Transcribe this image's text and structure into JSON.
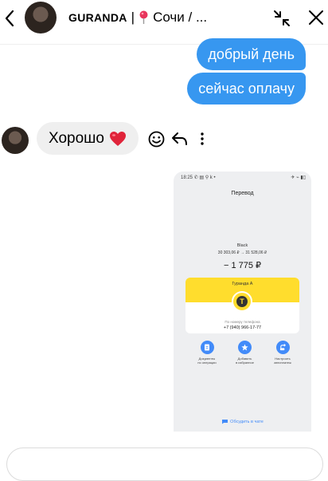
{
  "header": {
    "back_icon": "chevron-left-icon",
    "username": "GURANDA",
    "separator": "|",
    "location": "Сочи / ...",
    "collapse_icon": "collapse-arrows-icon",
    "close_icon": "close-icon"
  },
  "messages": {
    "outgoing": [
      {
        "text": "добрый день"
      },
      {
        "text": "сейчас оплачу"
      }
    ],
    "incoming": {
      "text": "Хорошо",
      "emoji": "heart-icon"
    }
  },
  "screenshot": {
    "status_time": "18:25",
    "status_icons": "✆ ▤ ⚲ k •",
    "status_right": "✈ ⌁ ▮▯",
    "title": "Перевод",
    "category": "Black",
    "balance": "30 303,06 ₽   →   31 528,06 ₽",
    "amount": "− 1 775 ₽",
    "recipient": "Гуранда А",
    "sub_label": "По номеру телефона",
    "phone": "+7 (940) 966-17-77",
    "actions": [
      {
        "label": "Документы\nпо операции",
        "icon": "document-icon"
      },
      {
        "label": "Добавить\nв избранное",
        "icon": "star-icon"
      },
      {
        "label": "Настроить\nавтоплатеж",
        "icon": "repeat-icon"
      }
    ],
    "chat_link": "Обсудить в чате"
  },
  "colors": {
    "outgoing_bubble": "#3797f0",
    "incoming_bubble": "#efefef",
    "bank_yellow": "#ffdd2d",
    "bank_blue": "#428bf9"
  }
}
